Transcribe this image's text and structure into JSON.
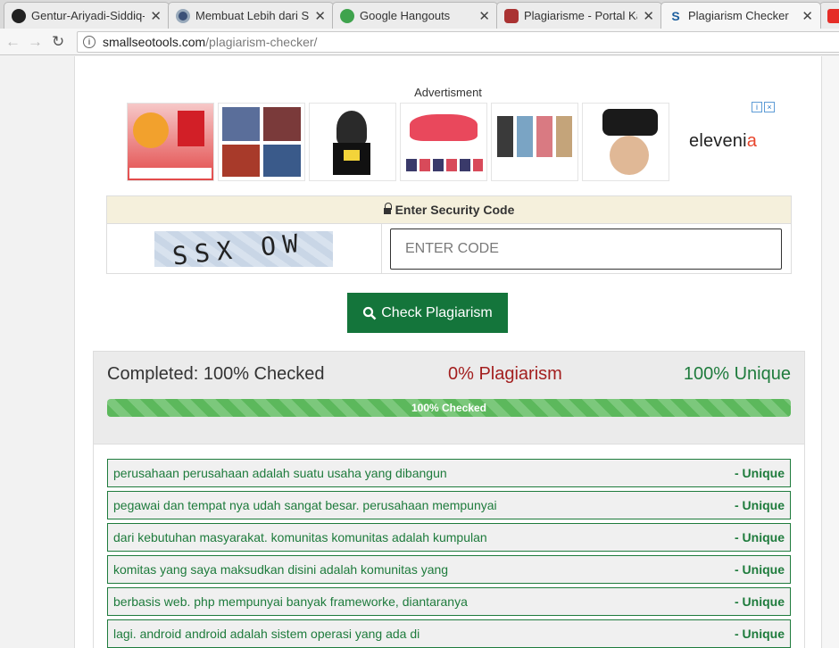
{
  "tabs": [
    {
      "title": "Gentur-Ariyadi-Siddiq-",
      "icon": "github-icon",
      "active": false
    },
    {
      "title": "Membuat Lebih dari Sa",
      "icon": "blog-icon",
      "active": false
    },
    {
      "title": "Google Hangouts",
      "icon": "hangouts-icon",
      "active": false
    },
    {
      "title": "Plagiarisme - Portal Ka",
      "icon": "shield-icon",
      "active": false
    },
    {
      "title": "Plagiarism Checker",
      "icon": "smallseotools-icon",
      "active": true
    }
  ],
  "address": {
    "host": "smallseotools.com",
    "path": "/plagiarism-checker/"
  },
  "ad": {
    "label": "Advertisment",
    "tiles": [
      "makodo promo",
      "pillows",
      "ice cream",
      "shoes",
      "jars",
      "vr headset"
    ],
    "brand_main": "eleveni",
    "brand_accent": "a",
    "badge_info": "i",
    "badge_close": "×"
  },
  "captcha": {
    "heading": "Enter Security Code",
    "image_text": "SSX OW",
    "input_placeholder": "ENTER CODE"
  },
  "check_button": {
    "label": "Check Plagiarism"
  },
  "results": {
    "completed": "Completed: 100% Checked",
    "plagiarism": "0% Plagiarism",
    "unique": "100% Unique",
    "progress_label": "100% Checked",
    "progress_value": 1.0,
    "tag": "- Unique",
    "sentences": [
      "perusahaan perusahaan adalah suatu usaha yang dibangun",
      "pegawai dan tempat nya udah sangat besar. perusahaan mempunyai",
      "dari kebutuhan masyarakat. komunitas komunitas adalah kumpulan",
      "komitas yang saya maksudkan disini adalah komunitas yang",
      "berbasis web. php mempunyai banyak frameworke, diantaranya",
      "lagi. android android adalah sistem operasi yang ada di"
    ]
  },
  "colors": {
    "accent_green": "#14753b",
    "unique_green": "#1e7b3c",
    "plag_red": "#a31f1f"
  }
}
